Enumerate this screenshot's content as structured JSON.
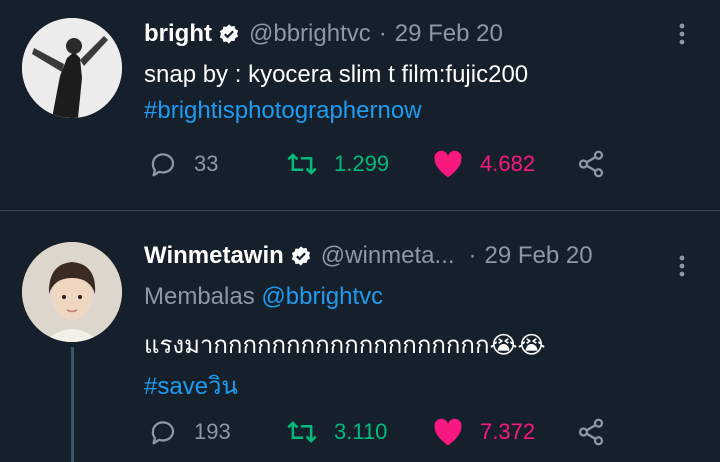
{
  "tweets": [
    {
      "name": "bright",
      "handle": "@bbrightvc",
      "separator": "·",
      "date": "29 Feb 20",
      "text": "snap by : kyocera slim t film:fujic200",
      "hashtag": "#brightisphotographernow",
      "replies": "33",
      "retweets": "1.299",
      "likes": "4.682",
      "avatar_icon": "profile-photo",
      "verified": true
    },
    {
      "name": "Winmetawin",
      "handle": "@winmeta...",
      "separator": "·",
      "date": "29 Feb 20",
      "reply_prefix": "Membalas",
      "reply_to": "@bbrightvc",
      "text": "แรงมากกกกกกกกกกกกกกกกกกก😭😭",
      "hashtag": "#saveวิน",
      "replies": "193",
      "retweets": "3.110",
      "likes": "7.372",
      "avatar_icon": "profile-photo",
      "verified": true
    }
  ],
  "colors": {
    "background": "#15202b",
    "divider": "#38444d",
    "secondary_text": "#8b98a5",
    "link": "#1d9bf0",
    "retweet": "#00ba7c",
    "like": "#f91880"
  },
  "icons": [
    "reply-icon",
    "retweet-icon",
    "heart-icon",
    "share-icon",
    "more-options-icon",
    "verified-badge-icon"
  ]
}
